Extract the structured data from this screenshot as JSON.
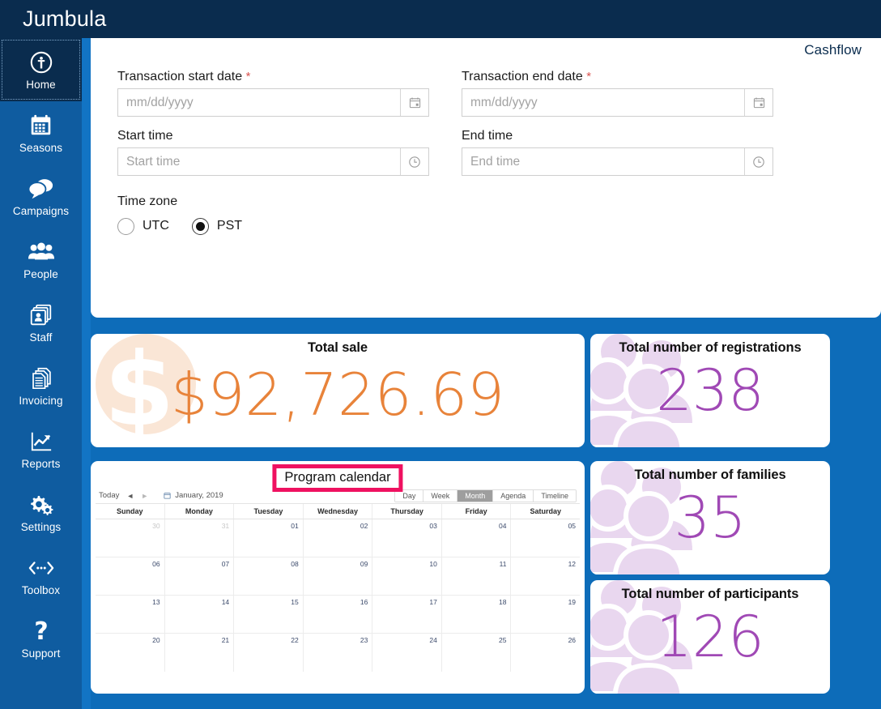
{
  "brand": "Jumbula",
  "sidebar": {
    "items": [
      {
        "label": "Home",
        "icon": "info-circle-icon",
        "active": true
      },
      {
        "label": "Seasons",
        "icon": "calendar-icon",
        "active": false
      },
      {
        "label": "Campaigns",
        "icon": "chat-bubbles-icon",
        "active": false
      },
      {
        "label": "People",
        "icon": "people-group-icon",
        "active": false
      },
      {
        "label": "Staff",
        "icon": "id-cards-icon",
        "active": false
      },
      {
        "label": "Invoicing",
        "icon": "documents-icon",
        "active": false
      },
      {
        "label": "Reports",
        "icon": "line-chart-icon",
        "active": false
      },
      {
        "label": "Settings",
        "icon": "gears-icon",
        "active": false
      },
      {
        "label": "Toolbox",
        "icon": "code-arrows-icon",
        "active": false
      },
      {
        "label": "Support",
        "icon": "question-mark-icon",
        "active": false
      }
    ]
  },
  "form": {
    "section_title": "Cashflow",
    "start_date": {
      "label": "Transaction start date",
      "required_marker": "*",
      "value": "",
      "placeholder": "mm/dd/yyyy",
      "icon": "calendar-icon"
    },
    "end_date": {
      "label": "Transaction end date",
      "required_marker": "*",
      "value": "",
      "placeholder": "mm/dd/yyyy",
      "icon": "calendar-icon"
    },
    "start_time": {
      "label": "Start time",
      "value": "",
      "placeholder": "Start time",
      "icon": "clock-icon"
    },
    "end_time": {
      "label": "End time",
      "value": "",
      "placeholder": "End time",
      "icon": "clock-icon"
    },
    "timezone": {
      "label": "Time zone",
      "options": [
        "UTC",
        "PST"
      ],
      "selected": "PST"
    }
  },
  "cards": {
    "total_sale": {
      "title": "Total sale",
      "value": "$92,726.69",
      "color": "#e8833a",
      "watermark": "dollar-sign-icon"
    },
    "registrations": {
      "title": "Total number of registrations",
      "value": "238",
      "color": "#a049b5",
      "watermark": "people-group-icon"
    },
    "families": {
      "title": "Total number of families",
      "value": "35",
      "color": "#a049b5",
      "watermark": "people-group-icon"
    },
    "participants": {
      "title": "Total number of participants",
      "value": "126",
      "color": "#a049b5",
      "watermark": "people-group-icon"
    }
  },
  "calendar": {
    "title": "Program calendar",
    "highlight_color": "#ef1160",
    "toolbar": {
      "today_label": "Today",
      "prev_label": "◄",
      "next_label": "►",
      "current_period": "January, 2019",
      "views": [
        "Day",
        "Week",
        "Month",
        "Agenda",
        "Timeline"
      ],
      "selected_view": "Month"
    },
    "day_headers": [
      "Sunday",
      "Monday",
      "Tuesday",
      "Wednesday",
      "Thursday",
      "Friday",
      "Saturday"
    ],
    "weeks": [
      [
        {
          "d": "30",
          "other": true
        },
        {
          "d": "31",
          "other": true
        },
        {
          "d": "01",
          "other": false
        },
        {
          "d": "02",
          "other": false
        },
        {
          "d": "03",
          "other": false
        },
        {
          "d": "04",
          "other": false
        },
        {
          "d": "05",
          "other": false
        }
      ],
      [
        {
          "d": "06",
          "other": false
        },
        {
          "d": "07",
          "other": false
        },
        {
          "d": "08",
          "other": false
        },
        {
          "d": "09",
          "other": false
        },
        {
          "d": "10",
          "other": false
        },
        {
          "d": "11",
          "other": false
        },
        {
          "d": "12",
          "other": false
        }
      ],
      [
        {
          "d": "13",
          "other": false
        },
        {
          "d": "14",
          "other": false
        },
        {
          "d": "15",
          "other": false
        },
        {
          "d": "16",
          "other": false
        },
        {
          "d": "17",
          "other": false
        },
        {
          "d": "18",
          "other": false
        },
        {
          "d": "19",
          "other": false
        }
      ],
      [
        {
          "d": "20",
          "other": false
        },
        {
          "d": "21",
          "other": false
        },
        {
          "d": "22",
          "other": false
        },
        {
          "d": "23",
          "other": false
        },
        {
          "d": "24",
          "other": false
        },
        {
          "d": "25",
          "other": false
        },
        {
          "d": "26",
          "other": false
        }
      ]
    ]
  },
  "theme": {
    "page_blue": "#0d6cb9",
    "topbar_navy": "#0a2c4e",
    "sidebar_blue": "#0f5ca0",
    "accent_orange": "#e8833a",
    "accent_purple": "#a049b5"
  }
}
